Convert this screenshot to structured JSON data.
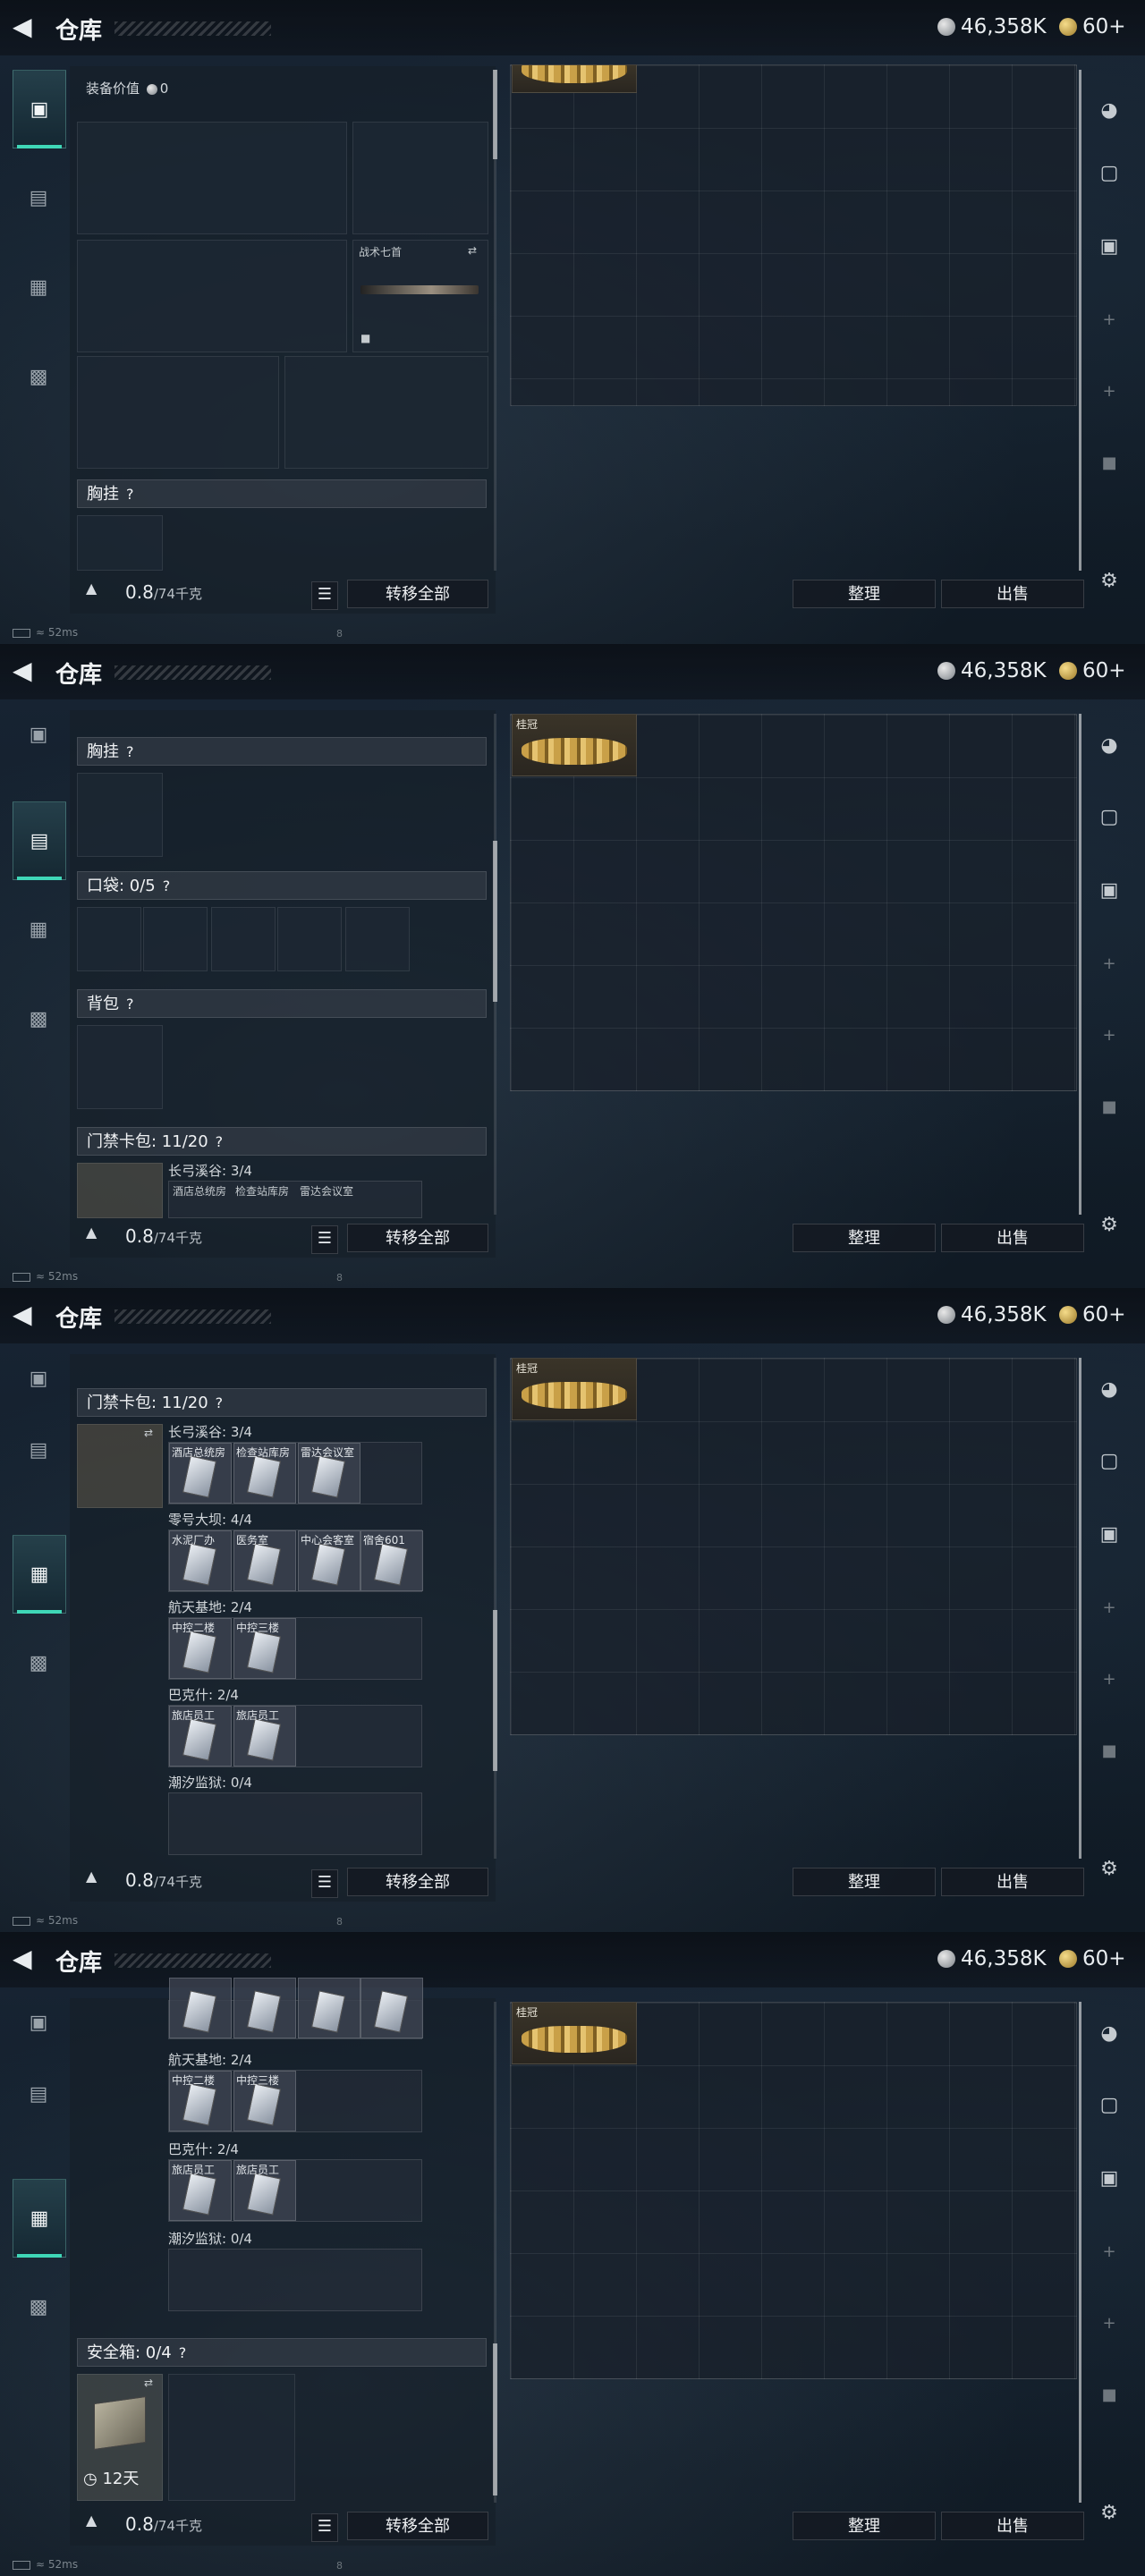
{
  "header": {
    "title": "仓库",
    "silver": "46,358K",
    "gold": "60+"
  },
  "footer": {
    "weight": "0.8",
    "weight_unit": "/74千克",
    "transfer_all": "转移全部",
    "sort": "整理",
    "sell": "出售"
  },
  "status": {
    "ping": "52ms",
    "b": "8"
  },
  "screen1": {
    "equip_value_label": "装备价值",
    "equip_value": "0",
    "knife_label": "战术七首",
    "rig_label": "胸挂"
  },
  "screen2": {
    "rig_label": "胸挂",
    "pocket_label": "口袋: 0/5",
    "backpack_label": "背包",
    "keycard_label": "门禁卡包: 11/20",
    "map1": "长弓溪谷: 3/4",
    "cards": [
      "酒店总统房",
      "检查站库房",
      "雷达会议室"
    ]
  },
  "screen3": {
    "keycard_label": "门禁卡包: 11/20",
    "map1": "长弓溪谷: 3/4",
    "map1_cards": [
      "酒店总统房",
      "检查站库房",
      "雷达会议室"
    ],
    "map2": "零号大坝: 4/4",
    "map2_cards": [
      "水泥厂办",
      "医务室",
      "中心会客室",
      "宿舍601"
    ],
    "map3": "航天基地: 2/4",
    "map3_cards": [
      "中控二楼",
      "中控三楼"
    ],
    "map4": "巴克什: 2/4",
    "map4_cards": [
      "旅店员工",
      "旅店员工"
    ],
    "map5": "潮汐监狱: 0/4"
  },
  "screen4": {
    "map3": "航天基地: 2/4",
    "map3_cards": [
      "中控二楼",
      "中控三楼"
    ],
    "map4": "巴克什: 2/4",
    "map4_cards": [
      "旅店员工",
      "旅店员工"
    ],
    "map5": "潮汐监狱: 0/4",
    "safe_label": "安全箱: 0/4",
    "safe_days": "12天"
  },
  "crown_label": "桂冠",
  "colors": {
    "accent": "#3fd7b7",
    "panel": "#16202b"
  }
}
